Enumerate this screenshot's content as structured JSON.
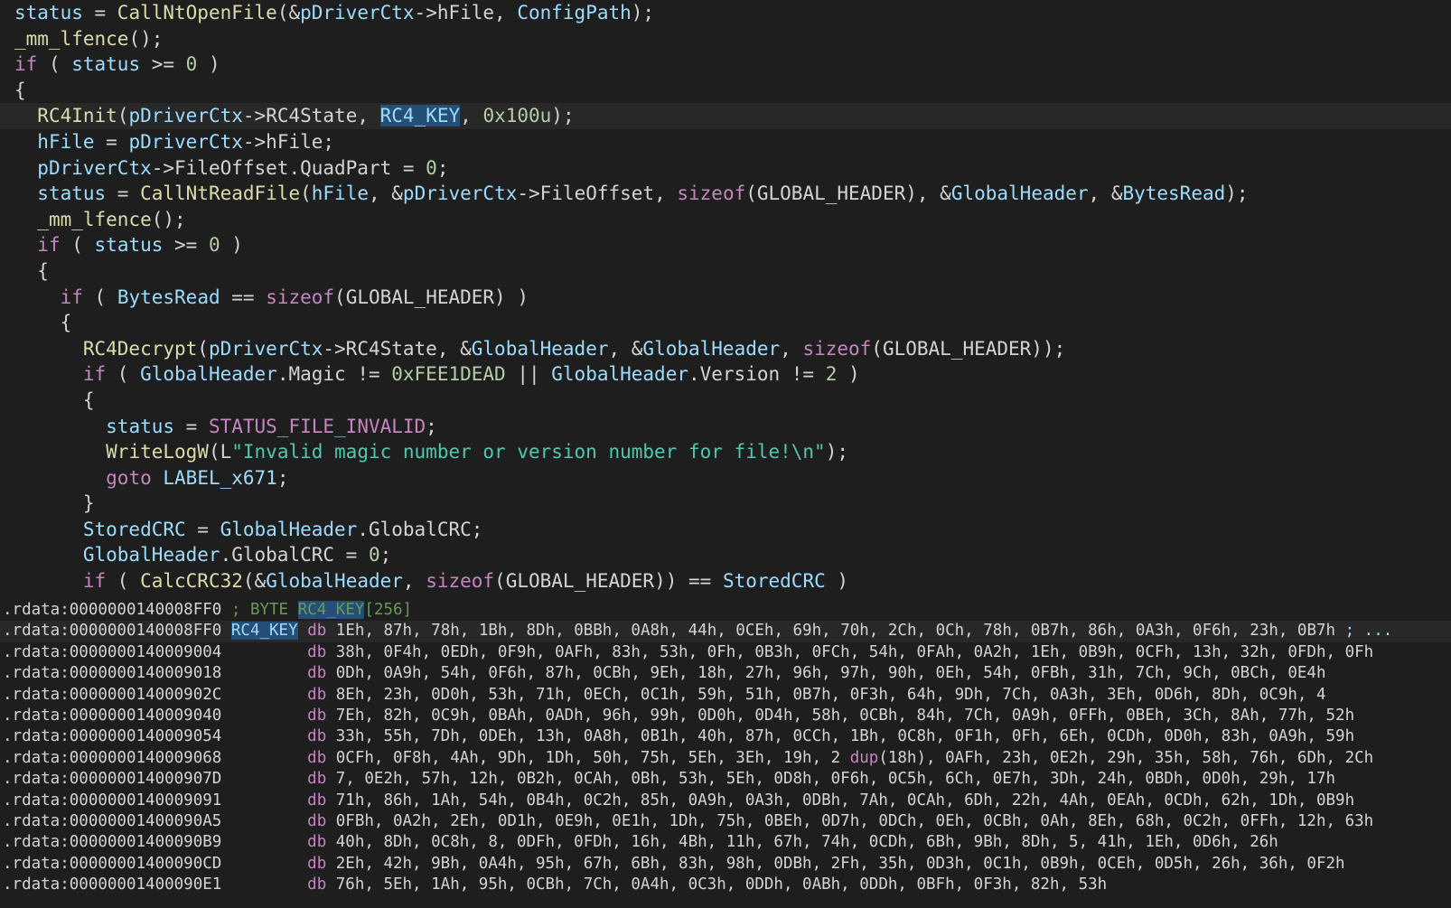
{
  "pseudocode": {
    "current_line": 4,
    "lines": [
      [
        [
          "var",
          "status"
        ],
        [
          "plain",
          " = "
        ],
        [
          "fn",
          "CallNtOpenFile"
        ],
        [
          "plain",
          "(&"
        ],
        [
          "var",
          "pDriverCtx"
        ],
        [
          "plain",
          "->hFile, "
        ],
        [
          "var",
          "ConfigPath"
        ],
        [
          "plain",
          ");"
        ]
      ],
      [
        [
          "fn",
          "_mm_lfence"
        ],
        [
          "plain",
          "();"
        ]
      ],
      [
        [
          "kw",
          "if"
        ],
        [
          "plain",
          " ( "
        ],
        [
          "var",
          "status"
        ],
        [
          "plain",
          " >= "
        ],
        [
          "num",
          "0"
        ],
        [
          "plain",
          " )"
        ]
      ],
      [
        [
          "plain",
          "{"
        ]
      ],
      [
        [
          "plain",
          "  "
        ],
        [
          "fn",
          "RC4Init"
        ],
        [
          "plain",
          "("
        ],
        [
          "var",
          "pDriverCtx"
        ],
        [
          "plain",
          "->RC4State, "
        ],
        [
          "hl",
          "RC4_KEY"
        ],
        [
          "plain",
          ", "
        ],
        [
          "num",
          "0x100u"
        ],
        [
          "plain",
          ");"
        ]
      ],
      [
        [
          "plain",
          "  "
        ],
        [
          "var",
          "hFile"
        ],
        [
          "plain",
          " = "
        ],
        [
          "var",
          "pDriverCtx"
        ],
        [
          "plain",
          "->hFile;"
        ]
      ],
      [
        [
          "plain",
          "  "
        ],
        [
          "var",
          "pDriverCtx"
        ],
        [
          "plain",
          "->FileOffset.QuadPart = "
        ],
        [
          "num",
          "0"
        ],
        [
          "plain",
          ";"
        ]
      ],
      [
        [
          "plain",
          "  "
        ],
        [
          "var",
          "status"
        ],
        [
          "plain",
          " = "
        ],
        [
          "fn",
          "CallNtReadFile"
        ],
        [
          "plain",
          "("
        ],
        [
          "var",
          "hFile"
        ],
        [
          "plain",
          ", &"
        ],
        [
          "var",
          "pDriverCtx"
        ],
        [
          "plain",
          "->FileOffset, "
        ],
        [
          "kw",
          "sizeof"
        ],
        [
          "plain",
          "(GLOBAL_HEADER), &"
        ],
        [
          "var",
          "GlobalHeader"
        ],
        [
          "plain",
          ", &"
        ],
        [
          "var",
          "BytesRead"
        ],
        [
          "plain",
          ");"
        ]
      ],
      [
        [
          "plain",
          "  "
        ],
        [
          "fn",
          "_mm_lfence"
        ],
        [
          "plain",
          "();"
        ]
      ],
      [
        [
          "plain",
          "  "
        ],
        [
          "kw",
          "if"
        ],
        [
          "plain",
          " ( "
        ],
        [
          "var",
          "status"
        ],
        [
          "plain",
          " >= "
        ],
        [
          "num",
          "0"
        ],
        [
          "plain",
          " )"
        ]
      ],
      [
        [
          "plain",
          "  {"
        ]
      ],
      [
        [
          "plain",
          "    "
        ],
        [
          "kw",
          "if"
        ],
        [
          "plain",
          " ( "
        ],
        [
          "var",
          "BytesRead"
        ],
        [
          "plain",
          " == "
        ],
        [
          "kw",
          "sizeof"
        ],
        [
          "plain",
          "(GLOBAL_HEADER) )"
        ]
      ],
      [
        [
          "plain",
          "    {"
        ]
      ],
      [
        [
          "plain",
          "      "
        ],
        [
          "fn",
          "RC4Decrypt"
        ],
        [
          "plain",
          "("
        ],
        [
          "var",
          "pDriverCtx"
        ],
        [
          "plain",
          "->RC4State, &"
        ],
        [
          "var",
          "GlobalHeader"
        ],
        [
          "plain",
          ", &"
        ],
        [
          "var",
          "GlobalHeader"
        ],
        [
          "plain",
          ", "
        ],
        [
          "kw",
          "sizeof"
        ],
        [
          "plain",
          "(GLOBAL_HEADER));"
        ]
      ],
      [
        [
          "plain",
          "      "
        ],
        [
          "kw",
          "if"
        ],
        [
          "plain",
          " ( "
        ],
        [
          "var",
          "GlobalHeader"
        ],
        [
          "plain",
          ".Magic != "
        ],
        [
          "num",
          "0xFEE1DEAD"
        ],
        [
          "plain",
          " || "
        ],
        [
          "var",
          "GlobalHeader"
        ],
        [
          "plain",
          ".Version != "
        ],
        [
          "num",
          "2"
        ],
        [
          "plain",
          " )"
        ]
      ],
      [
        [
          "plain",
          "      {"
        ]
      ],
      [
        [
          "plain",
          "        "
        ],
        [
          "var",
          "status"
        ],
        [
          "plain",
          " = "
        ],
        [
          "const",
          "STATUS_FILE_INVALID"
        ],
        [
          "plain",
          ";"
        ]
      ],
      [
        [
          "plain",
          "        "
        ],
        [
          "fn",
          "WriteLogW"
        ],
        [
          "plain",
          "(L"
        ],
        [
          "str",
          "\"Invalid magic number or version number for file!\\n\""
        ],
        [
          "plain",
          ");"
        ]
      ],
      [
        [
          "plain",
          "        "
        ],
        [
          "kw",
          "goto"
        ],
        [
          "plain",
          " "
        ],
        [
          "var",
          "LABEL_x671"
        ],
        [
          "plain",
          ";"
        ]
      ],
      [
        [
          "plain",
          "      }"
        ]
      ],
      [
        [
          "plain",
          "      "
        ],
        [
          "var",
          "StoredCRC"
        ],
        [
          "plain",
          " = "
        ],
        [
          "var",
          "GlobalHeader"
        ],
        [
          "plain",
          ".GlobalCRC;"
        ]
      ],
      [
        [
          "plain",
          "      "
        ],
        [
          "var",
          "GlobalHeader"
        ],
        [
          "plain",
          ".GlobalCRC = "
        ],
        [
          "num",
          "0"
        ],
        [
          "plain",
          ";"
        ]
      ],
      [
        [
          "plain",
          "      "
        ],
        [
          "kw",
          "if"
        ],
        [
          "plain",
          " ( "
        ],
        [
          "fn",
          "CalcCRC32"
        ],
        [
          "plain",
          "(&"
        ],
        [
          "var",
          "GlobalHeader"
        ],
        [
          "plain",
          ", "
        ],
        [
          "kw",
          "sizeof"
        ],
        [
          "plain",
          "(GLOBAL_HEADER)) == "
        ],
        [
          "var",
          "StoredCRC"
        ],
        [
          "plain",
          " )"
        ]
      ]
    ]
  },
  "disassembly": {
    "current_line": 1,
    "lines": [
      [
        [
          "addr",
          ".rdata:0000000140008FF0 "
        ],
        [
          "cmt",
          "; BYTE "
        ],
        [
          "cmthl",
          "RC4_KEY"
        ],
        [
          "cmt",
          "[256]"
        ]
      ],
      [
        [
          "addr",
          ".rdata:0000000140008FF0 "
        ],
        [
          "lblhl",
          "RC4_KEY"
        ],
        [
          "plain",
          " "
        ],
        [
          "db",
          "db"
        ],
        [
          "bytes",
          " 1Eh, 87h, 78h, 1Bh, 8Dh, 0BBh, 0A8h, 44h, 0CEh, 69h, 70h, 2Ch, 0Ch, 78h, 0B7h, 86h, 0A3h, 0F6h, 23h, 0B7h "
        ],
        [
          "ell",
          "; ..."
        ]
      ],
      [
        [
          "addr",
          ".rdata:0000000140009004         "
        ],
        [
          "db",
          "db"
        ],
        [
          "bytes",
          " 38h, 0F4h, 0EDh, 0F9h, 0AFh, 83h, 53h, 0Fh, 0B3h, 0FCh, 54h, 0FAh, 0A2h, 1Eh, 0B9h, 0CFh, 13h, 32h, 0FDh, 0Fh"
        ]
      ],
      [
        [
          "addr",
          ".rdata:0000000140009018         "
        ],
        [
          "db",
          "db"
        ],
        [
          "bytes",
          " 0Dh, 0A9h, 54h, 0F6h, 87h, 0CBh, 9Eh, 18h, 27h, 96h, 97h, 90h, 0Eh, 54h, 0FBh, 31h, 7Ch, 9Ch, 0BCh, 0E4h"
        ]
      ],
      [
        [
          "addr",
          ".rdata:000000014000902C         "
        ],
        [
          "db",
          "db"
        ],
        [
          "bytes",
          " 8Eh, 23h, 0D0h, 53h, 71h, 0ECh, 0C1h, 59h, 51h, 0B7h, 0F3h, 64h, 9Dh, 7Ch, 0A3h, 3Eh, 0D6h, 8Dh, 0C9h, 4"
        ]
      ],
      [
        [
          "addr",
          ".rdata:0000000140009040         "
        ],
        [
          "db",
          "db"
        ],
        [
          "bytes",
          " 7Eh, 82h, 0C9h, 0BAh, 0ADh, 96h, 99h, 0D0h, 0D4h, 58h, 0CBh, 84h, 7Ch, 0A9h, 0FFh, 0BEh, 3Ch, 8Ah, 77h, 52h"
        ]
      ],
      [
        [
          "addr",
          ".rdata:0000000140009054         "
        ],
        [
          "db",
          "db"
        ],
        [
          "bytes",
          " 33h, 55h, 7Dh, 0DEh, 13h, 0A8h, 0B1h, 40h, 87h, 0CCh, 1Bh, 0C8h, 0F1h, 0Fh, 6Eh, 0CDh, 0D0h, 83h, 0A9h, 59h"
        ]
      ],
      [
        [
          "addr",
          ".rdata:0000000140009068         "
        ],
        [
          "db",
          "db"
        ],
        [
          "bytes",
          " 0CFh, 0F8h, 4Ah, 9Dh, 1Dh, 50h, 75h, 5Eh, 3Eh, 19h, 2 "
        ],
        [
          "dup",
          "dup"
        ],
        [
          "bytes",
          "(18h), 0AFh, 23h, 0E2h, 29h, 35h, 58h, 76h, 6Dh, 2Ch"
        ]
      ],
      [
        [
          "addr",
          ".rdata:000000014000907D         "
        ],
        [
          "db",
          "db"
        ],
        [
          "bytes",
          " 7, 0E2h, 57h, 12h, 0B2h, 0CAh, 0Bh, 53h, 5Eh, 0D8h, 0F6h, 0C5h, 6Ch, 0E7h, 3Dh, 24h, 0BDh, 0D0h, 29h, 17h"
        ]
      ],
      [
        [
          "addr",
          ".rdata:0000000140009091         "
        ],
        [
          "db",
          "db"
        ],
        [
          "bytes",
          " 71h, 86h, 1Ah, 54h, 0B4h, 0C2h, 85h, 0A9h, 0A3h, 0DBh, 7Ah, 0CAh, 6Dh, 22h, 4Ah, 0EAh, 0CDh, 62h, 1Dh, 0B9h"
        ]
      ],
      [
        [
          "addr",
          ".rdata:00000001400090A5         "
        ],
        [
          "db",
          "db"
        ],
        [
          "bytes",
          " 0FBh, 0A2h, 2Eh, 0D1h, 0E9h, 0E1h, 1Dh, 75h, 0BEh, 0D7h, 0DCh, 0Eh, 0CBh, 0Ah, 8Eh, 68h, 0C2h, 0FFh, 12h, 63h"
        ]
      ],
      [
        [
          "addr",
          ".rdata:00000001400090B9         "
        ],
        [
          "db",
          "db"
        ],
        [
          "bytes",
          " 40h, 8Dh, 0C8h, 8, 0DFh, 0FDh, 16h, 4Bh, 11h, 67h, 74h, 0CDh, 6Bh, 9Bh, 8Dh, 5, 41h, 1Eh, 0D6h, 26h"
        ]
      ],
      [
        [
          "addr",
          ".rdata:00000001400090CD         "
        ],
        [
          "db",
          "db"
        ],
        [
          "bytes",
          " 2Eh, 42h, 9Bh, 0A4h, 95h, 67h, 6Bh, 83h, 98h, 0DBh, 2Fh, 35h, 0D3h, 0C1h, 0B9h, 0CEh, 0D5h, 26h, 36h, 0F2h"
        ]
      ],
      [
        [
          "addr",
          ".rdata:00000001400090E1         "
        ],
        [
          "db",
          "db"
        ],
        [
          "bytes",
          " 76h, 5Eh, 1Ah, 95h, 0CBh, 7Ch, 0A4h, 0C3h, 0DDh, 0ABh, 0DDh, 0BFh, 0F3h, 82h, 53h"
        ]
      ]
    ]
  }
}
